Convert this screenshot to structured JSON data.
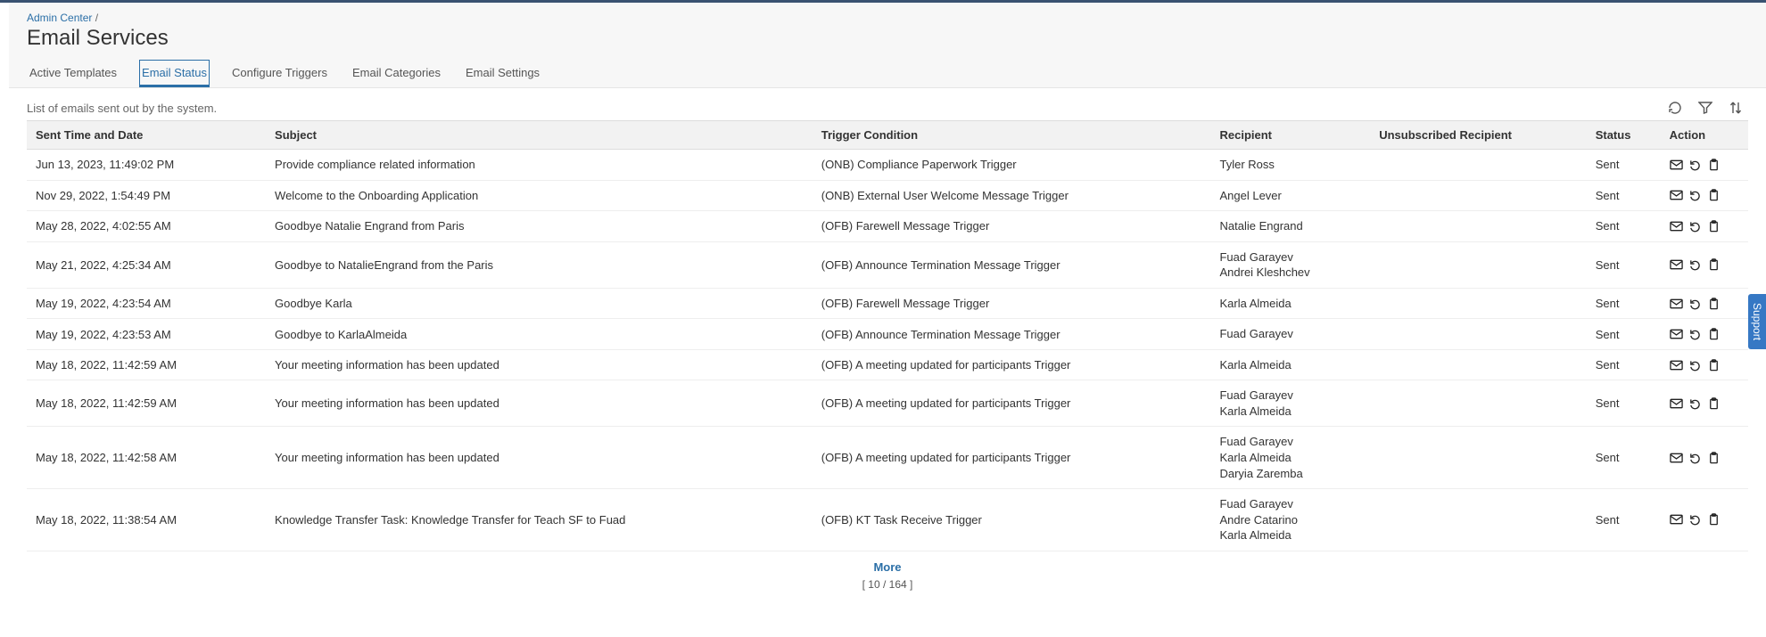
{
  "breadcrumb": {
    "root": "Admin Center",
    "sep": "/"
  },
  "page_title": "Email Services",
  "tabs": [
    {
      "label": "Active Templates",
      "active": false
    },
    {
      "label": "Email Status",
      "active": true
    },
    {
      "label": "Configure Triggers",
      "active": false
    },
    {
      "label": "Email Categories",
      "active": false
    },
    {
      "label": "Email Settings",
      "active": false
    }
  ],
  "description": "List of emails sent out by the system.",
  "toolbar": {
    "refresh": "refresh",
    "filter": "filter",
    "sort": "sort"
  },
  "columns": {
    "date": "Sent Time and Date",
    "subject": "Subject",
    "trigger": "Trigger Condition",
    "recipient": "Recipient",
    "unsub": "Unsubscribed Recipient",
    "status": "Status",
    "action": "Action"
  },
  "rows": [
    {
      "date": "Jun 13, 2023, 11:49:02 PM",
      "subject": "Provide compliance related information",
      "trigger": "(ONB) Compliance Paperwork Trigger",
      "recipients": [
        "Tyler Ross"
      ],
      "status": "Sent"
    },
    {
      "date": "Nov 29, 2022, 1:54:49 PM",
      "subject": "Welcome to the Onboarding Application",
      "trigger": "(ONB) External User Welcome Message Trigger",
      "recipients": [
        "Angel Lever"
      ],
      "status": "Sent"
    },
    {
      "date": "May 28, 2022, 4:02:55 AM",
      "subject": "Goodbye Natalie Engrand from Paris",
      "trigger": "(OFB) Farewell Message Trigger",
      "recipients": [
        "Natalie Engrand"
      ],
      "status": "Sent"
    },
    {
      "date": "May 21, 2022, 4:25:34 AM",
      "subject": "Goodbye to NatalieEngrand from the Paris",
      "trigger": "(OFB) Announce Termination Message Trigger",
      "recipients": [
        "Fuad Garayev",
        "Andrei Kleshchev"
      ],
      "status": "Sent"
    },
    {
      "date": "May 19, 2022, 4:23:54 AM",
      "subject": "Goodbye Karla",
      "trigger": "(OFB) Farewell Message Trigger",
      "recipients": [
        "Karla Almeida"
      ],
      "status": "Sent"
    },
    {
      "date": "May 19, 2022, 4:23:53 AM",
      "subject": "Goodbye to KarlaAlmeida",
      "trigger": "(OFB) Announce Termination Message Trigger",
      "recipients": [
        "Fuad Garayev"
      ],
      "status": "Sent"
    },
    {
      "date": "May 18, 2022, 11:42:59 AM",
      "subject": "Your meeting information has been updated",
      "trigger": "(OFB) A meeting updated for participants Trigger",
      "recipients": [
        "Karla Almeida"
      ],
      "status": "Sent"
    },
    {
      "date": "May 18, 2022, 11:42:59 AM",
      "subject": "Your meeting information has been updated",
      "trigger": "(OFB) A meeting updated for participants Trigger",
      "recipients": [
        "Fuad Garayev",
        "Karla Almeida"
      ],
      "status": "Sent"
    },
    {
      "date": "May 18, 2022, 11:42:58 AM",
      "subject": "Your meeting information has been updated",
      "trigger": "(OFB) A meeting updated for participants Trigger",
      "recipients": [
        "Fuad Garayev",
        "Karla Almeida",
        "Daryia Zaremba"
      ],
      "status": "Sent"
    },
    {
      "date": "May 18, 2022, 11:38:54 AM",
      "subject": "Knowledge Transfer Task: Knowledge Transfer for Teach SF to Fuad",
      "trigger": "(OFB) KT Task Receive Trigger",
      "recipients": [
        "Fuad Garayev",
        "Andre Catarino",
        "Karla Almeida"
      ],
      "status": "Sent"
    }
  ],
  "footer": {
    "more": "More",
    "count": "[ 10 / 164 ]"
  },
  "support_label": "Support"
}
